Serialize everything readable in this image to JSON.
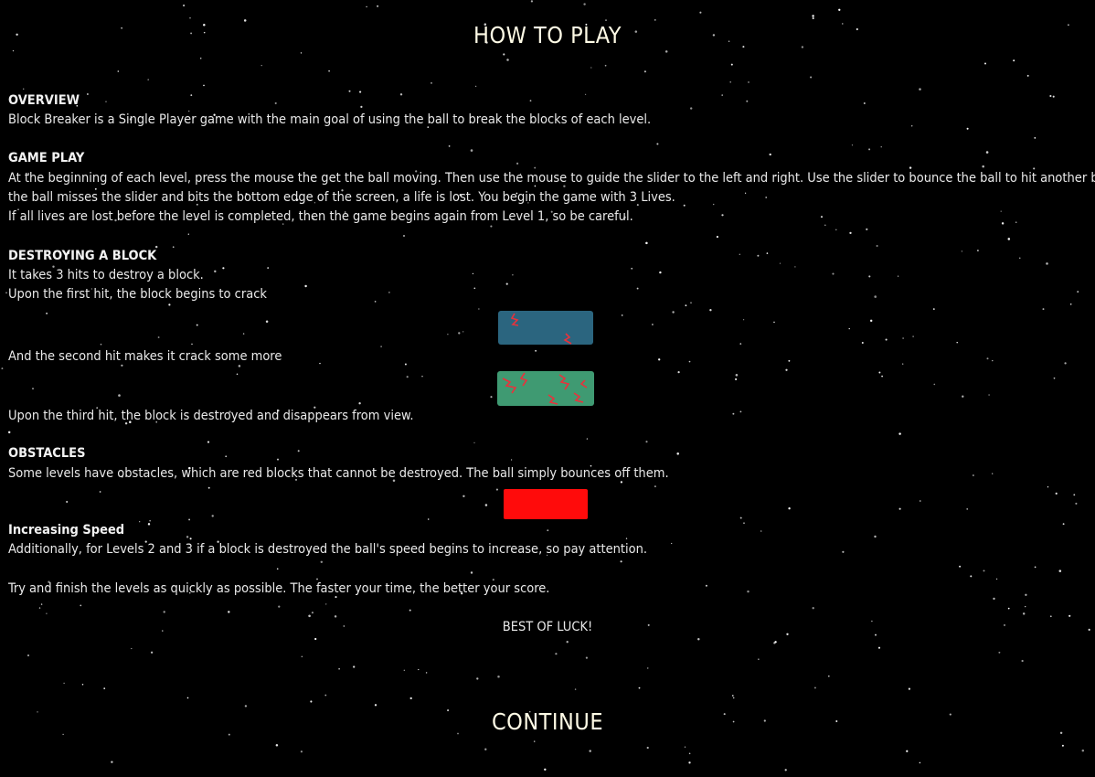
{
  "title": "HOW TO PLAY",
  "sections": {
    "overview": {
      "heading": "OVERVIEW",
      "text": "Block Breaker is a Single Player game with the main goal of using the ball to break the blocks of each level."
    },
    "gameplay": {
      "heading": "GAME PLAY",
      "line1": "At the beginning of each level, press the mouse the get the ball moving. Then use the mouse to guide the slider to the left and right. Use the slider to bounce the ball to hit another block. If",
      "line2": "the ball misses the slider and bits the bottom edge of the screen, a life is lost. You begin the game with 3 Lives.",
      "line3": "If all lives are lost before the level is completed, then the game begins again from Level 1, so be careful."
    },
    "destroying": {
      "heading": "DESTROYING A BLOCK",
      "line1": "It takes 3 hits to destroy a block.",
      "line2": "Upon the first hit, the block begins to crack",
      "line3": "And the second hit makes it crack some more",
      "line4": "Upon the third hit, the block is destroyed and disappears from view."
    },
    "obstacles": {
      "heading": "OBSTACLES",
      "text": "Some levels have obstacles, which are red blocks that cannot be destroyed. The ball simply bounces off them."
    },
    "speed": {
      "heading": "Increasing Speed",
      "text": "Additionally, for Levels 2 and 3 if a block is destroyed the ball's speed begins to increase, so pay attention."
    },
    "finish": "Try and finish the levels as quickly as possible. The faster your time, the better your score.",
    "luck": "BEST OF LUCK!"
  },
  "continue_label": "CONTINUE",
  "colors": {
    "background": "#000000",
    "block_cracked_once": "#2b657f",
    "block_cracked_twice": "#3f9a72",
    "crack": "#e8323c",
    "obstacle": "#ff0b0b",
    "title_text": "#fffbe6"
  },
  "icons": {
    "block1": "cracked-block-icon",
    "block2": "heavily-cracked-block-icon",
    "obstacle": "obstacle-block-icon"
  }
}
